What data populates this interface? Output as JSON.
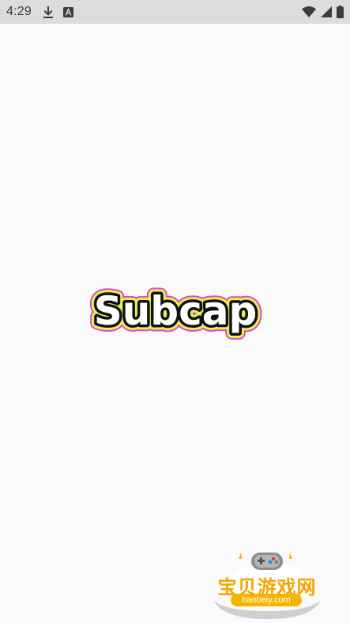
{
  "status_bar": {
    "time": "4:29",
    "icons": [
      "download-icon",
      "font-a-icon",
      "wifi-icon",
      "signal-icon",
      "battery-icon"
    ]
  },
  "splash": {
    "logo_text": "Subcap",
    "colors": {
      "outer_outline": "#e04bc9",
      "yellow_halo": "#e8f050",
      "text_fill": "#ffffff",
      "text_stroke": "#111111"
    }
  },
  "watermark": {
    "chinese": "宝贝游戏网",
    "url": "baobeiy.com",
    "accent": "#f5a400"
  }
}
